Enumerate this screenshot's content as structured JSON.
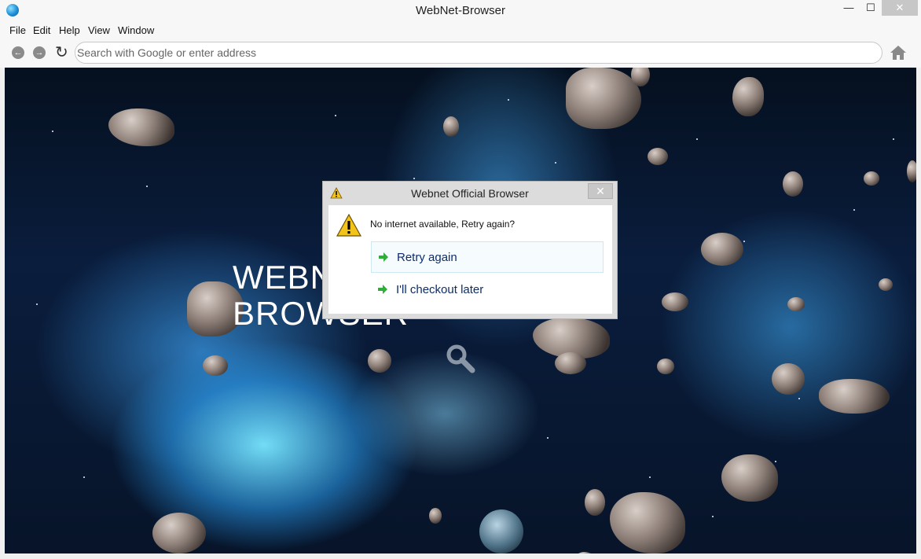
{
  "window": {
    "title": "WebNet-Browser",
    "minimize": "—",
    "maximize": "☐",
    "close": "✕"
  },
  "menu": [
    "File",
    "Edit",
    "Help",
    "View",
    "Window"
  ],
  "navbar": {
    "back": "←",
    "forward": "→",
    "reload": "↻",
    "address_placeholder": "Search with Google or enter address"
  },
  "page": {
    "hero_line1": "WEBN",
    "hero_line2": "BROWSER"
  },
  "dialog": {
    "title": "Webnet Official Browser",
    "close": "✕",
    "message": "No internet available, Retry again?",
    "options": [
      {
        "label": "Retry again",
        "selected": true
      },
      {
        "label": "I'll checkout later",
        "selected": false
      }
    ],
    "icon": "warning-icon"
  },
  "colors": {
    "arrow_green": "#2fae3a",
    "option_text": "#0d2d6b",
    "warning_yellow": "#f2c318"
  }
}
